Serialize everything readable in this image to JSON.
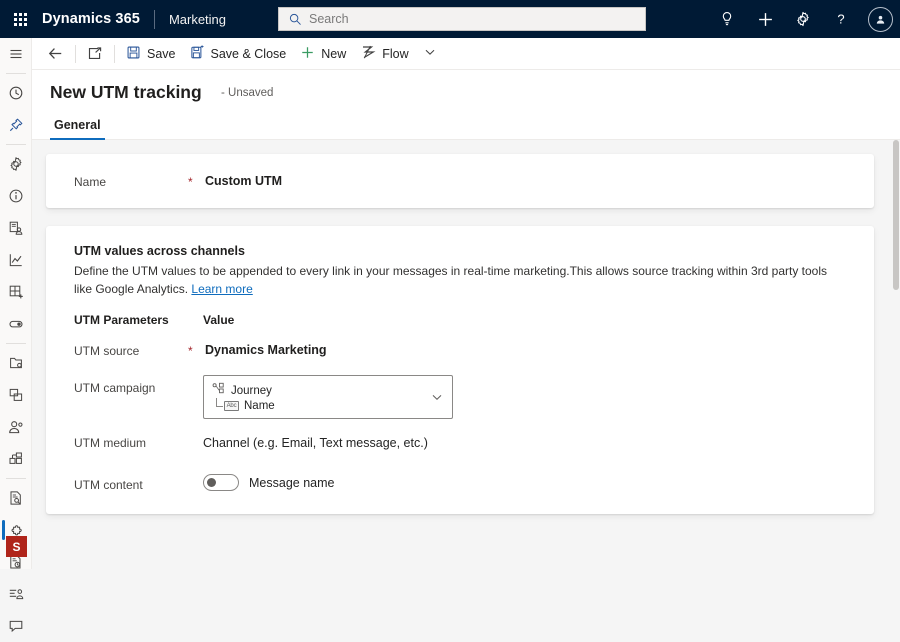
{
  "topnav": {
    "waffle_label": "app-launcher",
    "brand": "Dynamics 365",
    "app_name": "Marketing",
    "search": {
      "placeholder": "Search",
      "value": ""
    },
    "icons": [
      {
        "name": "lightbulb-icon",
        "label": "Insights"
      },
      {
        "name": "plus-icon",
        "label": "Quick create"
      },
      {
        "name": "gear-icon",
        "label": "Settings"
      },
      {
        "name": "question-icon",
        "label": "Help"
      }
    ],
    "avatar_label": "User account",
    "bg_color": "#001a35"
  },
  "commandbar": {
    "back_label": "Back",
    "popout_label": "Open in new window",
    "save_label": "Save",
    "save_close_label": "Save & Close",
    "new_label": "New",
    "flow_label": "Flow",
    "overflow_label": "More commands"
  },
  "form": {
    "title": "New UTM tracking",
    "state": "- Unsaved",
    "tabs": [
      {
        "label": "General",
        "active": true
      }
    ]
  },
  "name_field": {
    "label": "Name",
    "required_marker": "*",
    "value": "Custom UTM"
  },
  "section": {
    "title": "UTM values across channels",
    "description": "Define the UTM values to be appended to every link in your messages in real-time marketing.This allows source tracking within 3rd party tools like Google Analytics.",
    "learn_more": "Learn more"
  },
  "table": {
    "header_parameter": "UTM Parameters",
    "header_value": "Value",
    "rows": [
      {
        "label": "UTM source",
        "required_marker": "*",
        "type": "text",
        "value": "Dynamics Marketing"
      },
      {
        "label": "UTM campaign",
        "required_marker": "",
        "type": "combobox",
        "token_primary": "Journey",
        "token_secondary": "Name",
        "token_primary_icon": "journey-icon",
        "token_secondary_icon": "abc-field-icon",
        "abc_text": "Abc",
        "chevron": "chevron-down-icon"
      },
      {
        "label": "UTM medium",
        "required_marker": "",
        "type": "text",
        "value": "Channel (e.g. Email, Text message, etc.)"
      },
      {
        "label": "UTM content",
        "required_marker": "",
        "type": "toggle",
        "toggle_state": "off",
        "value": "Message name"
      }
    ]
  },
  "sidebar": {
    "items": [
      {
        "name": "sidebar-hamburger",
        "label": "Expand navigation pane"
      },
      {
        "name": "sidebar-recent",
        "label": "Recent"
      },
      {
        "name": "sidebar-pinned",
        "label": "Pinned"
      },
      {
        "name": "sidebar-settings",
        "label": "Settings"
      },
      {
        "name": "sidebar-overview",
        "label": "Overview"
      },
      {
        "name": "sidebar-audience",
        "label": "Audience"
      },
      {
        "name": "sidebar-analytics",
        "label": "Analytics"
      },
      {
        "name": "sidebar-templates",
        "label": "Templates"
      },
      {
        "name": "sidebar-toggles",
        "label": "Feature switches"
      },
      {
        "name": "sidebar-assets",
        "label": "Assets"
      },
      {
        "name": "sidebar-copy",
        "label": "Duplicates"
      },
      {
        "name": "sidebar-contacts",
        "label": "Contacts"
      },
      {
        "name": "sidebar-segments",
        "label": "Segments"
      },
      {
        "name": "sidebar-forms",
        "label": "Forms"
      },
      {
        "name": "sidebar-extensions",
        "label": "Extensions",
        "selected": true
      },
      {
        "name": "sidebar-schedule",
        "label": "Schedule"
      },
      {
        "name": "sidebar-lists",
        "label": "Lists"
      },
      {
        "name": "sidebar-messages",
        "label": "Messages"
      }
    ],
    "badge": "S",
    "badge_color": "#b0251b"
  },
  "theme": {
    "accent": "#0f6cbd",
    "page_bg": "#f5f5f5",
    "card_bg": "#ffffff",
    "required_red": "#a4262c"
  }
}
